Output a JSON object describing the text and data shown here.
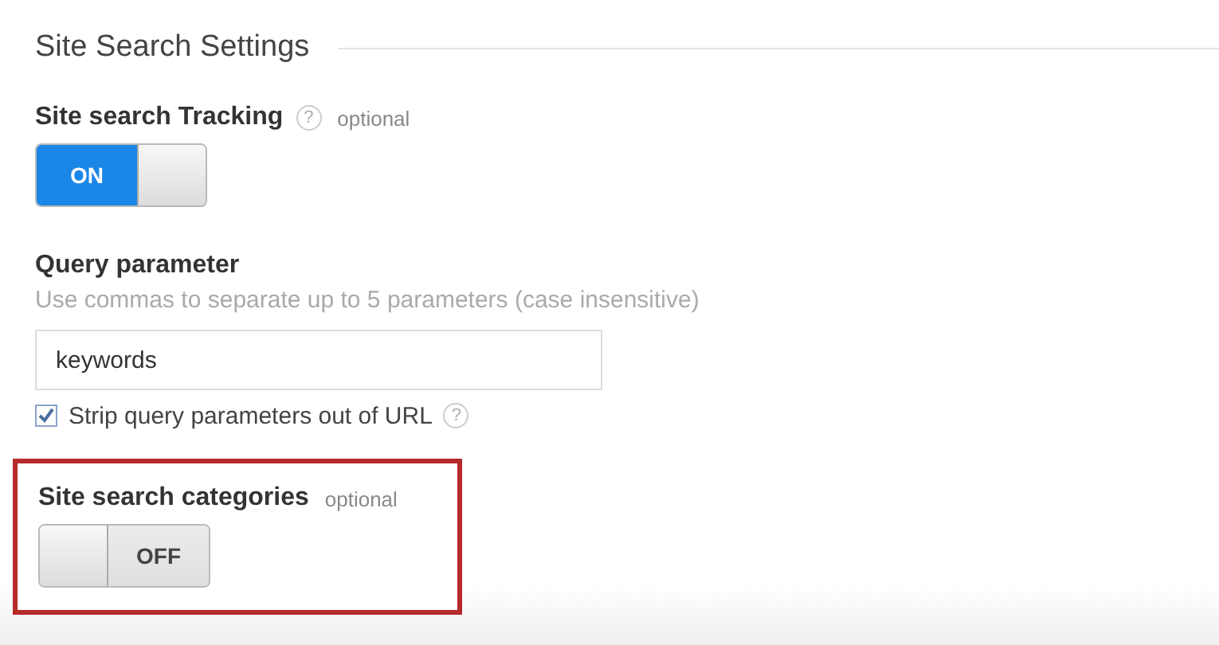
{
  "section": {
    "title": "Site Search Settings"
  },
  "tracking": {
    "label": "Site search Tracking",
    "help": "?",
    "optional": "optional",
    "toggle": {
      "on": true,
      "label": "ON"
    }
  },
  "query": {
    "label": "Query parameter",
    "hint": "Use commas to separate up to 5 parameters (case insensitive)",
    "value": "keywords",
    "strip": {
      "label": "Strip query parameters out of URL",
      "checked": true,
      "help": "?"
    }
  },
  "categories": {
    "label": "Site search categories",
    "optional": "optional",
    "highlighted": true,
    "toggle": {
      "on": false,
      "label": "OFF"
    }
  }
}
